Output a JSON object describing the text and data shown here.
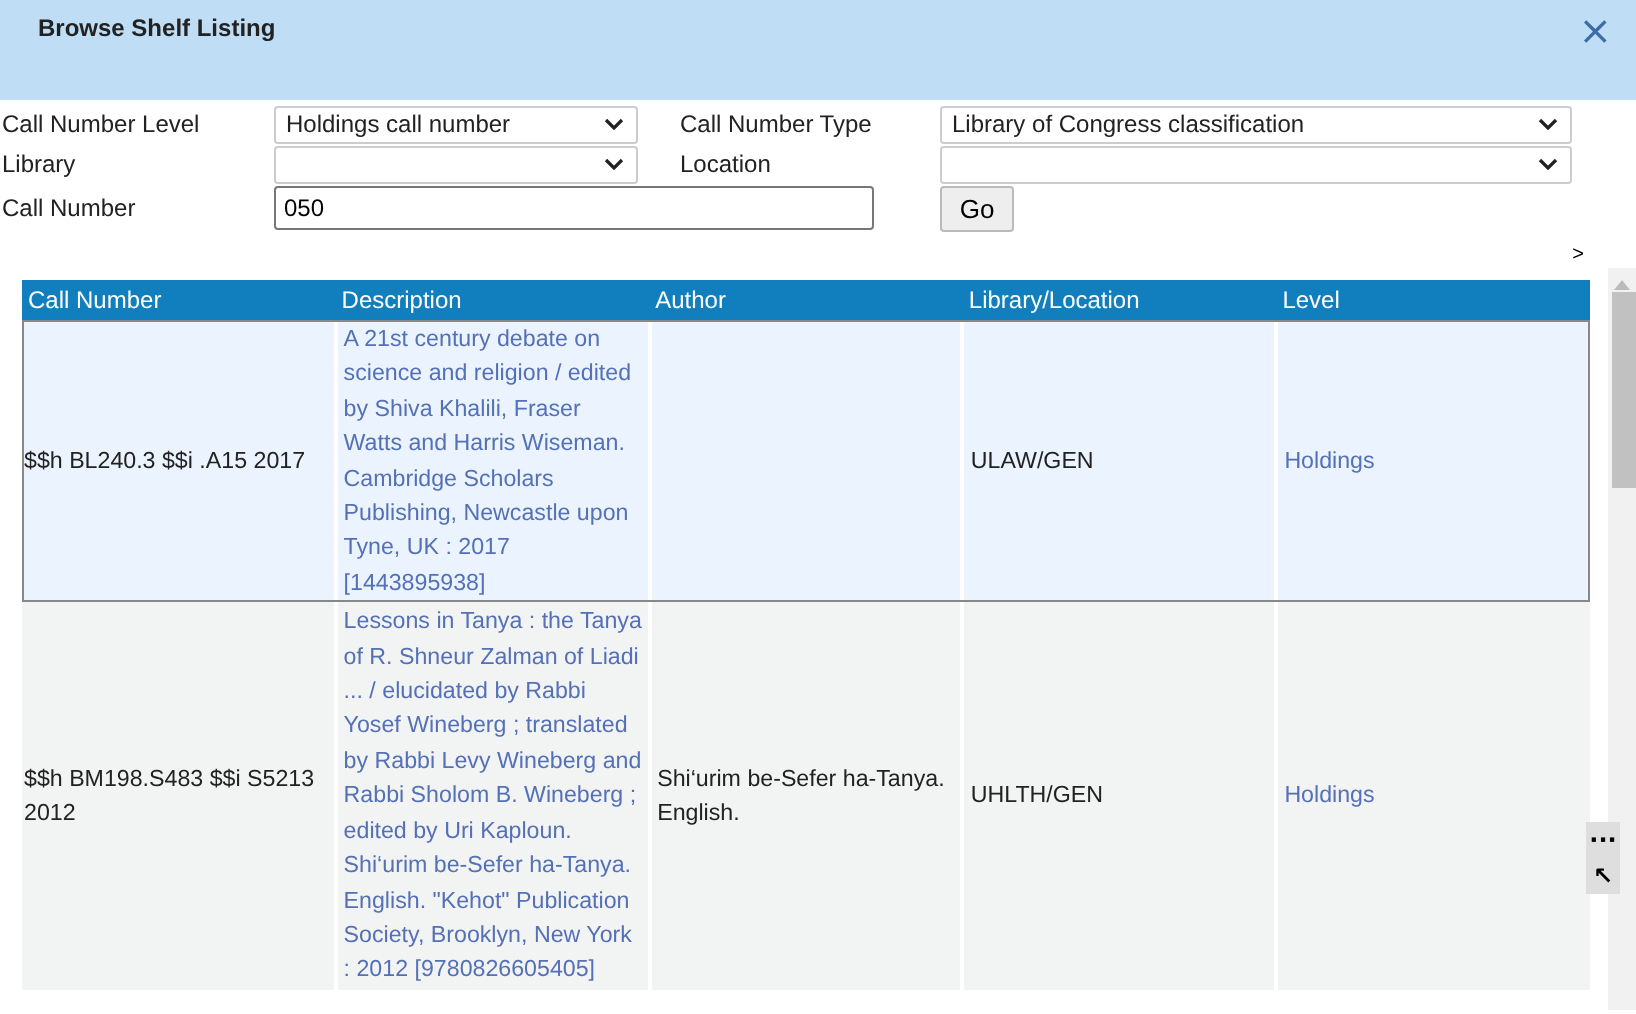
{
  "dialog": {
    "title": "Browse Shelf Listing",
    "close_glyph": "×"
  },
  "form": {
    "fields": [
      {
        "label": "Call Number Level",
        "kind": "select",
        "value": "Holdings call number"
      },
      {
        "label": "Call Number Type",
        "kind": "select",
        "value": "Library of Congress classification"
      },
      {
        "label": "Library",
        "kind": "select"
      },
      {
        "label": "Location",
        "kind": "select"
      },
      {
        "label": "Call Number",
        "kind": "text",
        "value": "050"
      }
    ],
    "go_button": "Go",
    "next_glyph": ">"
  },
  "table": {
    "columns": [
      "Call Number",
      "Description",
      "Author",
      "Library/Location",
      "Level"
    ],
    "rows": [
      {
        "selected": true,
        "call_number": "$$h BL240.3 $$i .A15 2017",
        "description": "A 21st century debate on science and religion / edited by Shiva Khalili, Fraser Watts and Harris Wiseman. Cambridge Scholars Publishing, Newcastle upon Tyne, UK : 2017 [1443895938]",
        "author": "",
        "library_location": "ULAW/GEN",
        "level": "Holdings"
      },
      {
        "selected": false,
        "call_number": "$$h BM198.S483 $$i S5213 2012",
        "description": "Lessons in Tanya : the Tanya of R. Shneur Zalman of Liadi ... / elucidated by Rabbi Yosef Wineberg ; translated by Rabbi Levy Wineberg and Rabbi Sholom B. Wineberg ; edited by Uri Kaploun. Shi‘urim be-Sefer ha-Tanya. English. \"Kehot\" Publication Society, Brooklyn, New York : 2012 [9780826605405]",
        "author": "Shi‘urim be-Sefer ha-Tanya. English.",
        "library_location": "UHLTH/GEN",
        "level": "Holdings"
      }
    ]
  },
  "floating_buttons": [
    "···",
    "↖"
  ]
}
